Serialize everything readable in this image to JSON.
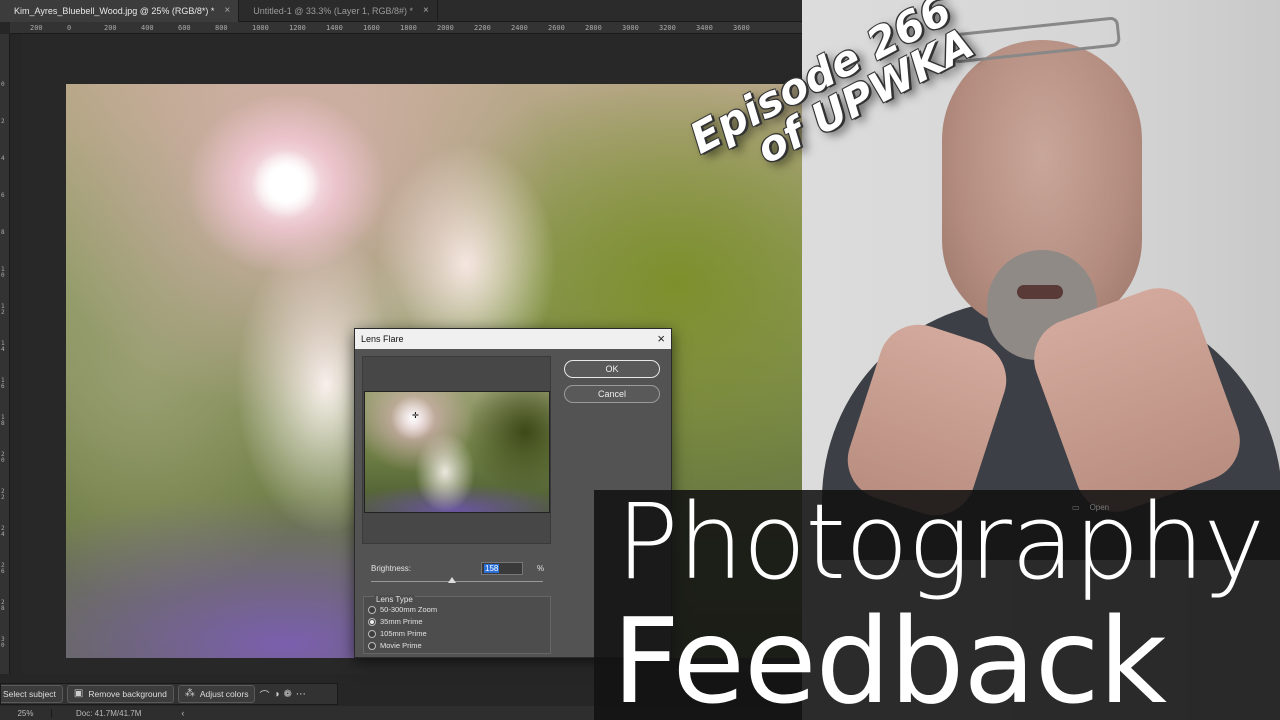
{
  "photoshop": {
    "tabs": [
      {
        "label": "Kim_Ayres_Bluebell_Wood.jpg @ 25% (RGB/8*) *",
        "close": "×"
      },
      {
        "label": "Untitled-1 @ 33.3% (Layer 1, RGB/8#) *",
        "close": "×"
      }
    ],
    "ruler_ticks": [
      "200",
      "0",
      "200",
      "400",
      "600",
      "800",
      "1000",
      "1200",
      "1400",
      "1600",
      "1800",
      "2000",
      "2200",
      "2400",
      "2600",
      "2800",
      "3000",
      "3200",
      "3400",
      "3600"
    ],
    "ruler_v_ticks": [
      "0",
      "2",
      "4",
      "6",
      "8",
      "1 0",
      "1 2",
      "1 4",
      "1 6",
      "1 8",
      "2 0",
      "2 2",
      "2 4",
      "2 6",
      "2 8",
      "3 0"
    ],
    "context_bar": {
      "select_subject": "Select subject",
      "remove_background": "Remove background",
      "adjust_colors": "Adjust colors"
    },
    "status": {
      "zoom": "25%",
      "doc": "Doc: 41.7M/41.7M",
      "chevron": "‹"
    }
  },
  "lens_flare": {
    "title": "Lens Flare",
    "close": "×",
    "ok_label": "OK",
    "cancel_label": "Cancel",
    "brightness_label": "Brightness:",
    "brightness_value": "158",
    "brightness_unit": "%",
    "brightness_slider_fraction": 0.47,
    "lens_type_label": "Lens Type",
    "lens_options": [
      "50-300mm Zoom",
      "35mm Prime",
      "105mm Prime",
      "Movie Prime"
    ],
    "selected_lens": "35mm Prime"
  },
  "overlay": {
    "episode_line1": "Episode 266",
    "episode_line2": "of UPWKA",
    "title_line1": "Photography",
    "title_line2": "Feedback",
    "ghost_menu_item": "Open"
  }
}
